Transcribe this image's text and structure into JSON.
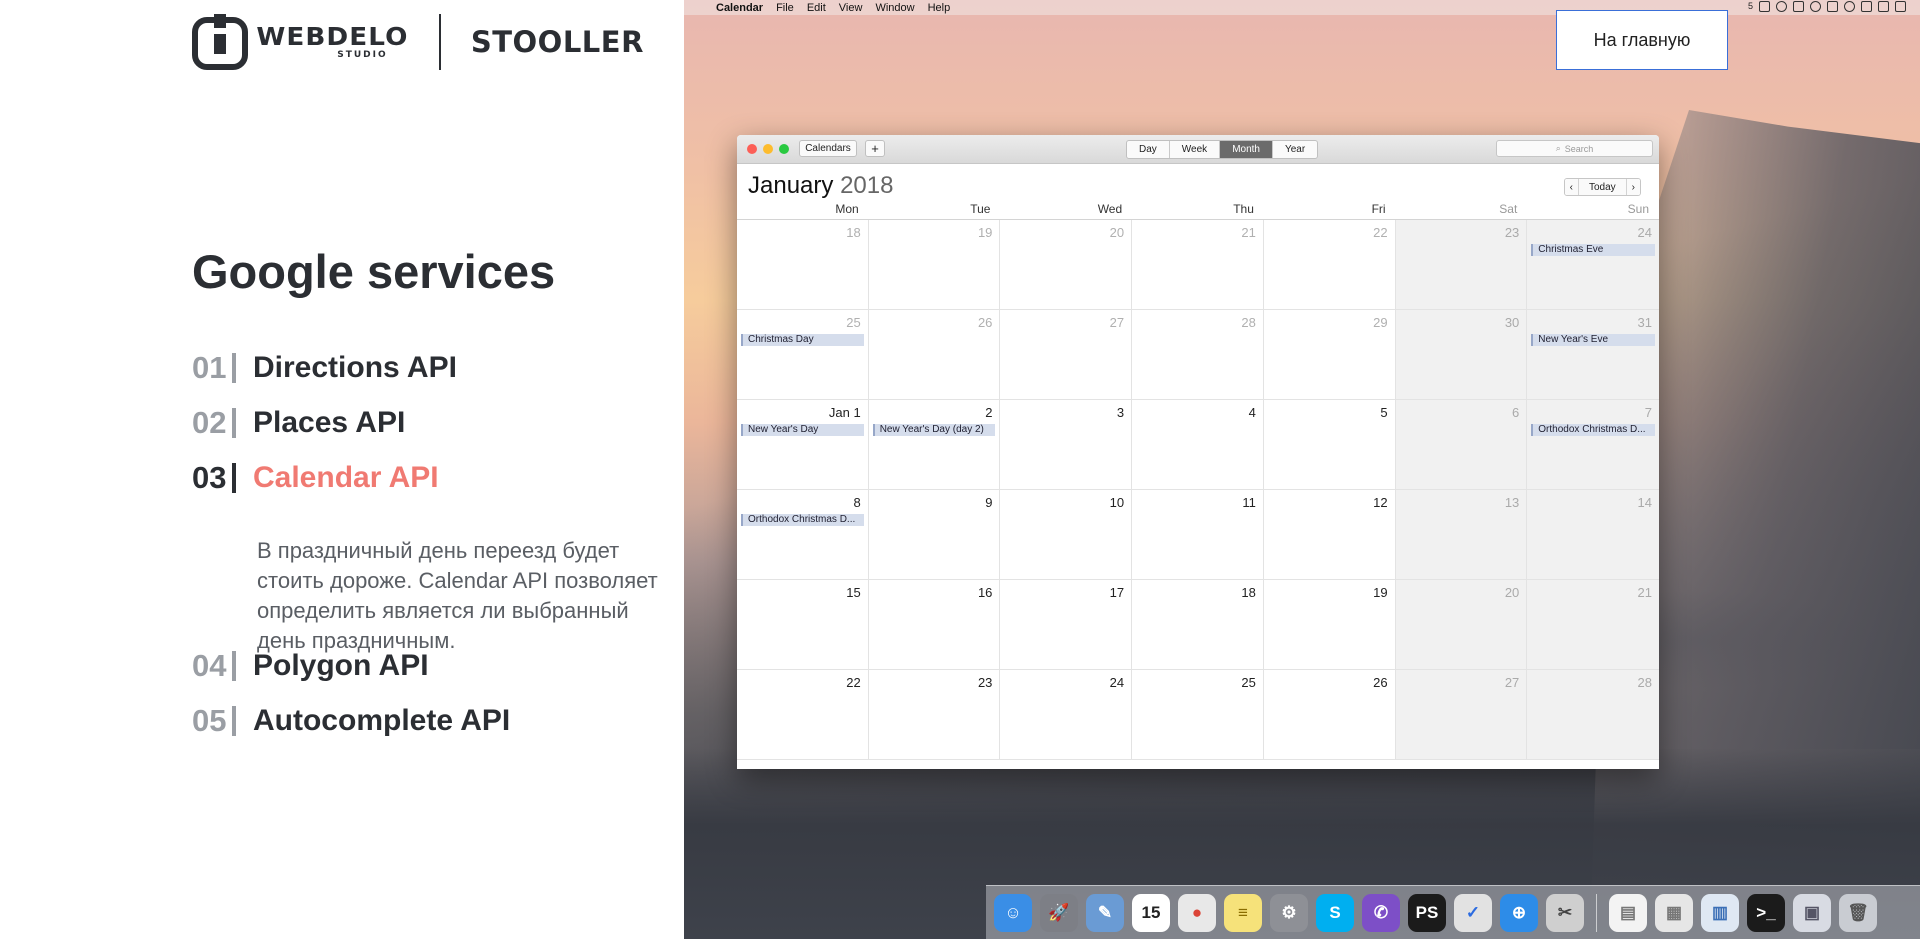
{
  "brand": {
    "name": "WEBDELO",
    "sub": "STUDIO",
    "project": "STOOLLER"
  },
  "section_title": "Google services",
  "apis": [
    {
      "num": "01",
      "name": "Directions API",
      "active": false
    },
    {
      "num": "02",
      "name": "Places API",
      "active": false
    },
    {
      "num": "03",
      "name": "Calendar API",
      "active": true
    },
    {
      "num": "04",
      "name": "Polygon API",
      "active": false
    },
    {
      "num": "05",
      "name": "Autocomplete API",
      "active": false
    }
  ],
  "active_api_description": "В праздничный день переезд будет стоить дороже. Calendar API позволяет определить является ли выбранный день праздничным.",
  "home_button": "На главную",
  "menubar": {
    "app": "Calendar",
    "items": [
      "File",
      "Edit",
      "View",
      "Window",
      "Help"
    ],
    "status_badge": "5"
  },
  "calendar": {
    "toolbar": {
      "calendars": "Calendars",
      "add": "+",
      "views": [
        "Day",
        "Week",
        "Month",
        "Year"
      ],
      "active_view": "Month",
      "search_placeholder": "Search"
    },
    "month": "January",
    "year": "2018",
    "nav": {
      "prev": "‹",
      "today": "Today",
      "next": "›"
    },
    "weekdays": [
      "Mon",
      "Tue",
      "Wed",
      "Thu",
      "Fri",
      "Sat",
      "Sun"
    ],
    "weeks": [
      [
        {
          "d": "18",
          "other": true
        },
        {
          "d": "19",
          "other": true
        },
        {
          "d": "20",
          "other": true
        },
        {
          "d": "21",
          "other": true
        },
        {
          "d": "22",
          "other": true
        },
        {
          "d": "23",
          "other": true
        },
        {
          "d": "24",
          "other": true,
          "event": "Christmas Eve"
        }
      ],
      [
        {
          "d": "25",
          "other": true,
          "event": "Christmas Day"
        },
        {
          "d": "26",
          "other": true
        },
        {
          "d": "27",
          "other": true
        },
        {
          "d": "28",
          "other": true
        },
        {
          "d": "29",
          "other": true
        },
        {
          "d": "30",
          "other": true
        },
        {
          "d": "31",
          "other": true,
          "event": "New Year's Eve"
        }
      ],
      [
        {
          "d": "Jan 1",
          "event": "New Year's Day"
        },
        {
          "d": "2",
          "event": "New Year's Day (day 2)"
        },
        {
          "d": "3"
        },
        {
          "d": "4"
        },
        {
          "d": "5"
        },
        {
          "d": "6"
        },
        {
          "d": "7",
          "event": "Orthodox Christmas D..."
        }
      ],
      [
        {
          "d": "8",
          "event": "Orthodox Christmas D..."
        },
        {
          "d": "9"
        },
        {
          "d": "10"
        },
        {
          "d": "11"
        },
        {
          "d": "12"
        },
        {
          "d": "13"
        },
        {
          "d": "14"
        }
      ],
      [
        {
          "d": "15"
        },
        {
          "d": "16"
        },
        {
          "d": "17"
        },
        {
          "d": "18"
        },
        {
          "d": "19"
        },
        {
          "d": "20"
        },
        {
          "d": "21"
        }
      ],
      [
        {
          "d": "22"
        },
        {
          "d": "23"
        },
        {
          "d": "24"
        },
        {
          "d": "25"
        },
        {
          "d": "26"
        },
        {
          "d": "27"
        },
        {
          "d": "28"
        }
      ]
    ]
  },
  "dock": {
    "apps": [
      {
        "name": "finder",
        "glyph": "☺",
        "color": "#3a8ee6"
      },
      {
        "name": "launchpad",
        "glyph": "🚀",
        "color": "#7d7f86"
      },
      {
        "name": "preview",
        "glyph": "✎",
        "color": "#6a9bd4"
      },
      {
        "name": "calendar",
        "glyph": "15",
        "color": "#ffffff",
        "text": "#222"
      },
      {
        "name": "chrome",
        "glyph": "●",
        "color": "#e8e8e8",
        "text": "#db4437"
      },
      {
        "name": "notes",
        "glyph": "≡",
        "color": "#f6e27a",
        "text": "#8a6d00"
      },
      {
        "name": "system-preferences",
        "glyph": "⚙",
        "color": "#8e9096"
      },
      {
        "name": "skype",
        "glyph": "S",
        "color": "#00aff0"
      },
      {
        "name": "viber",
        "glyph": "✆",
        "color": "#7d4fc7"
      },
      {
        "name": "phpstorm",
        "glyph": "PS",
        "color": "#1b1b1b"
      },
      {
        "name": "things",
        "glyph": "✓",
        "color": "#e2e2e2",
        "text": "#2b6be0"
      },
      {
        "name": "safari",
        "glyph": "⊕",
        "color": "#2d8ce8"
      },
      {
        "name": "script-editor",
        "glyph": "✂",
        "color": "#cfcfcf",
        "text": "#444"
      }
    ],
    "docs": [
      {
        "name": "document",
        "glyph": "▤",
        "color": "#f3f3f3",
        "text": "#777"
      },
      {
        "name": "file-stack",
        "glyph": "▦",
        "color": "#e6e6e6",
        "text": "#777"
      },
      {
        "name": "downloads",
        "glyph": "▥",
        "color": "#dfe8f3",
        "text": "#3b6fb6"
      },
      {
        "name": "terminal",
        "glyph": ">_",
        "color": "#1b1b1b"
      },
      {
        "name": "window-preview",
        "glyph": "▣",
        "color": "#d8dbe3",
        "text": "#556"
      },
      {
        "name": "trash",
        "glyph": "🗑",
        "color": "#c9ccd2",
        "text": "#555"
      }
    ]
  }
}
